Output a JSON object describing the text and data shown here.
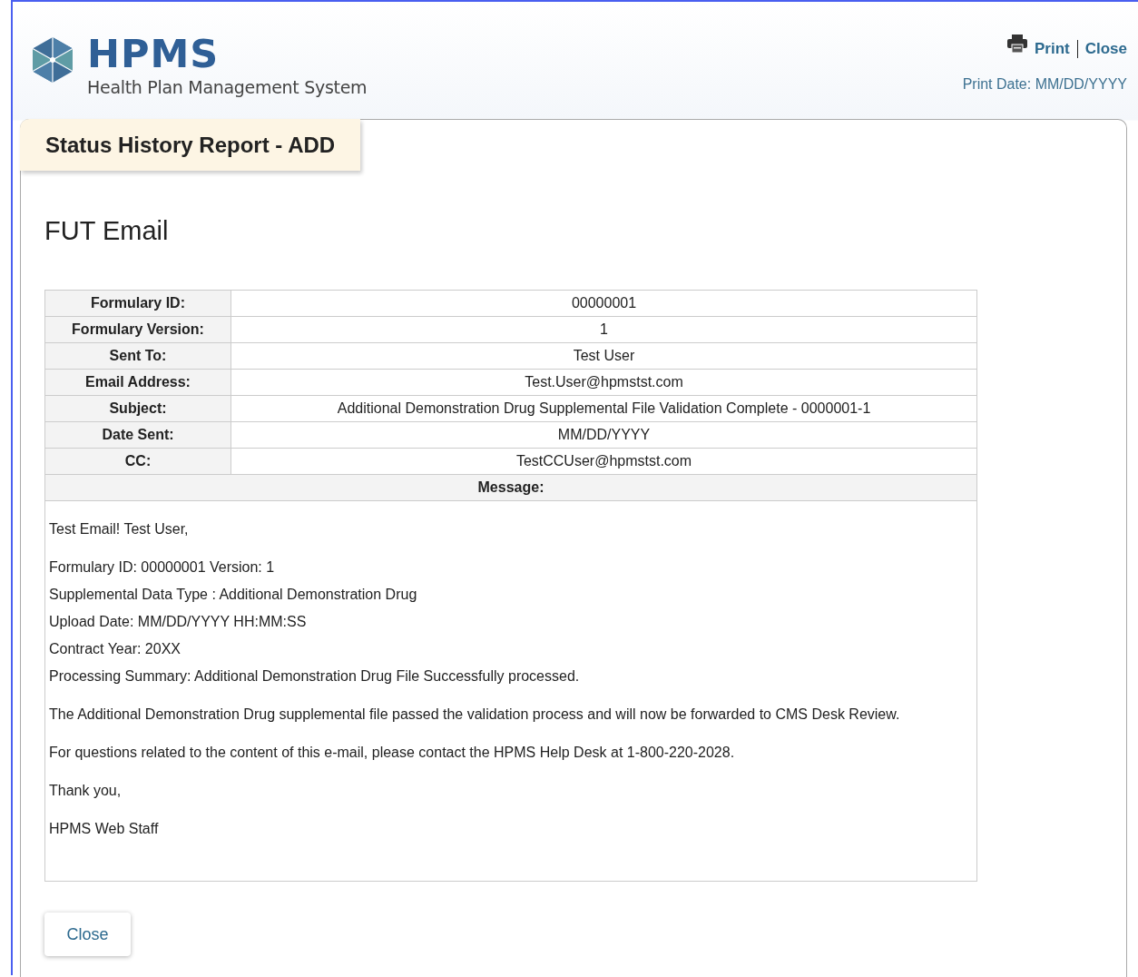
{
  "header": {
    "logo": {
      "title": "HPMS",
      "subtitle": "Health Plan Management System"
    },
    "actions": [
      {
        "label": "Print",
        "kind": "print"
      },
      {
        "label": "Close",
        "kind": "plain"
      }
    ],
    "print_date": "Print Date: MM/DD/YYYY"
  },
  "report": {
    "title": "Status History Report - ADD",
    "heading": "FUT Email",
    "fields": [
      {
        "label": "Formulary ID:",
        "value": "00000001"
      },
      {
        "label": "Formulary Version:",
        "value": "1"
      },
      {
        "label": "Sent To:",
        "value": "Test User"
      },
      {
        "label": "Email Address:",
        "value": "Test.User@hpmstst.com"
      },
      {
        "label": "Subject:",
        "value": "Additional Demonstration Drug Supplemental File Validation Complete - 0000001-1"
      },
      {
        "label": "Date Sent:",
        "value": "MM/DD/YYYY"
      },
      {
        "label": "CC:",
        "value": "TestCCUser@hpmstst.com"
      }
    ],
    "message_label": "Message:",
    "message": [
      [
        "Test Email! Test User,"
      ],
      [
        "Formulary ID: 00000001 Version: 1",
        "Supplemental Data Type : Additional Demonstration Drug",
        "Upload Date: MM/DD/YYYY HH:MM:SS",
        "Contract Year: 20XX",
        "Processing Summary: Additional Demonstration Drug File Successfully processed."
      ],
      [
        "The Additional Demonstration Drug supplemental file passed the validation process and will now be forwarded to CMS Desk Review."
      ],
      [
        "For questions related to the content of this e-mail, please contact the HPMS Help Desk at 1-800-220-2028."
      ],
      [
        "Thank you,"
      ],
      [
        "HPMS Web Staff"
      ]
    ],
    "close_button": "Close"
  }
}
